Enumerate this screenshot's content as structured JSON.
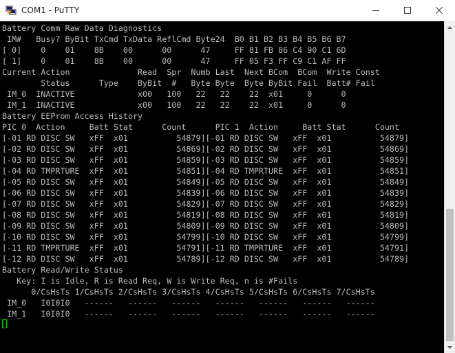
{
  "window": {
    "title": "COM1 - PuTTY",
    "app_icon": "putty-icon"
  },
  "terminal": {
    "lines": [
      "Battery Comm Raw Data Diagnostics",
      " IM#   Busy? ByBit TxCmd TxData ReflCmd Byte24  B0 B1 B2 B3 B4 B5 B6 B7",
      "[ 0]    0    01    8B    00      00      47     FF 81 FB 86 C4 90 C1 6D",
      "[ 1]    0    01    8B    00      00      47     FF 05 F3 FF C9 C1 AF FF",
      "Current Action              Read  Spr  Numb Last  Next BCom  BCom  Write Const",
      "        Status      Type    ByBit  #   Byte Byte  Byte ByBit Fail  Batt# Fail",
      " IM_0  INACTIVE             x00   100   22   22    22  x01     0      0",
      " IM_1  INACTIVE             x00   100   22   22    22  x01     0      0",
      "Battery EEProm Access History",
      "PIC 0  Action     Batt Stat      Count      PIC 1  Action     Batt Stat      Count",
      "[-01 RD DISC SW   xFF  x01          54879][-01 RD DISC SW   xFF  x01          54879]",
      "[-02 RD DISC SW   xFF  x01          54869][-02 RD DISC SW   xFF  x01          54869]",
      "[-03 RD DISC SW   xFF  x01          54859][-03 RD DISC SW   xFF  x01          54859]",
      "[-04 RD TMPRTURE  xFF  x01          54851][-04 RD TMPRTURE  xFF  x01          54851]",
      "[-05 RD DISC SW   xFF  x01          54849][-05 RD DISC SW   xFF  x01          54849]",
      "[-06 RD DISC SW   xFF  x01          54839][-06 RD DISC SW   xFF  x01          54839]",
      "[-07 RD DISC SW   xFF  x01          54829][-07 RD DISC SW   xFF  x01          54829]",
      "[-08 RD DISC SW   xFF  x01          54819][-08 RD DISC SW   xFF  x01          54819]",
      "[-09 RD DISC SW   xFF  x01          54809][-09 RD DISC SW   xFF  x01          54809]",
      "[-10 RD DISC SW   xFF  x01          54799][-10 RD DISC SW   xFF  x01          54799]",
      "[-11 RD TMPRTURE  xFF  x01          54791][-11 RD TMPRTURE  xFF  x01          54791]",
      "[-12 RD DISC SW   xFF  x01          54789][-12 RD DISC SW   xFF  x01          54789]",
      "Battery Read/Write Status",
      "   Key: I is Idle, R is Read Req, W is Write Req, n is #Fails",
      "      0/CsHsTs 1/CsHsTs 2/CsHsTs 3/CsHsTs 4/CsHsTs 5/CsHsTs 6/CsHsTs 7/CsHsTs",
      " IM_0   I0I0I0   ------   ------   ------   ------   ------   ------   ------",
      " IM_1   I0I0I0   ------   ------   ------   ------   ------   ------   ------"
    ]
  },
  "colors": {
    "terminal_bg": "#000000",
    "terminal_fg": "#bbbbbb",
    "cursor": "#00cc00"
  }
}
